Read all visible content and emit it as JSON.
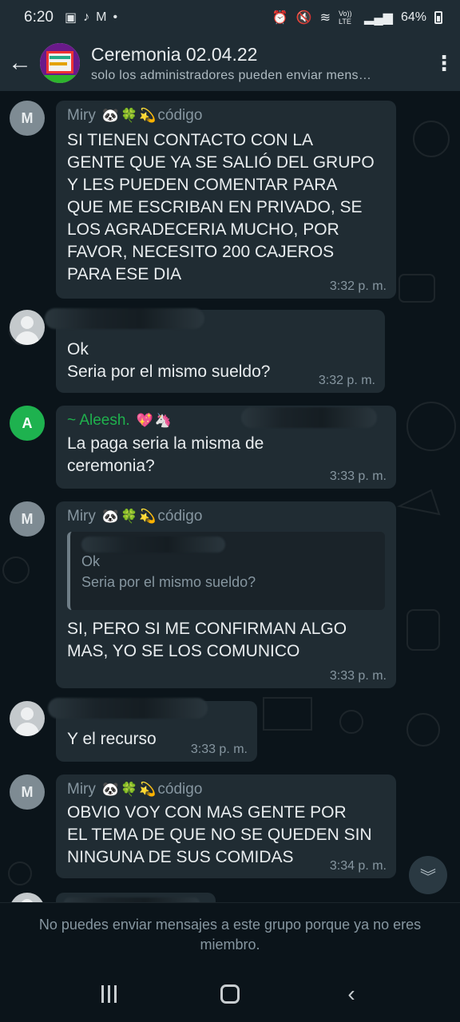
{
  "status": {
    "time": "6:20",
    "icons_left": [
      "gallery-icon",
      "tiktok-icon",
      "gmail-icon",
      "dot-icon"
    ],
    "icons_right": [
      "alarm-icon",
      "mute-icon",
      "wifi-icon",
      "volte-icon",
      "signal-icon"
    ],
    "volte": "Vo)) LTE",
    "battery": "64%"
  },
  "header": {
    "title": "Ceremonia 02.04.22",
    "subtitle": "solo los administradores pueden enviar mens…"
  },
  "messages": [
    {
      "sender": "Miry",
      "sender_suffix": "código",
      "emojis": [
        "🐼",
        "🍀",
        "💫"
      ],
      "avatar_letter": "M",
      "text": "SI TIENEN CONTACTO CON LA\nGENTE QUE YA SE SALIÓ DEL GRUPO\nY LES PUEDEN COMENTAR PARA\nQUE ME ESCRIBAN EN PRIVADO, SE\nLOS AGRADECERIA MUCHO, POR\nFAVOR, NECESITO 200 CAJEROS\nPARA ESE DIA",
      "time": "3:32 p. m."
    },
    {
      "text": "Ok\nSeria por el mismo sueldo?",
      "time": "3:32 p. m."
    },
    {
      "sender": "~ Aleesh.",
      "emojis": [
        "💖",
        "🦄"
      ],
      "avatar_letter": "A",
      "text": "La paga seria la misma de\nceremonia?",
      "time": "3:33 p. m."
    },
    {
      "sender": "Miry",
      "sender_suffix": "código",
      "emojis": [
        "🐼",
        "🍀",
        "💫"
      ],
      "avatar_letter": "M",
      "quote_line1": "Ok",
      "quote_line2": "Seria por el mismo sueldo?",
      "text": "SI, PERO SI ME CONFIRMAN ALGO\nMAS, YO SE LOS COMUNICO",
      "time": "3:33 p. m."
    },
    {
      "text": "Y el recurso",
      "time": "3:33 p. m."
    },
    {
      "sender": "Miry",
      "sender_suffix": "código",
      "emojis": [
        "🐼",
        "🍀",
        "💫"
      ],
      "avatar_letter": "M",
      "text": "OBVIO VOY CON MAS GENTE POR\nEL TEMA DE QUE NO SE QUEDEN SIN\nNINGUNA DE SUS COMIDAS",
      "time": "3:34 p. m."
    }
  ],
  "footer": {
    "notice": "No puedes enviar mensajes a este grupo porque ya no eres miembro."
  },
  "colors": {
    "background": "#0b141a",
    "bar": "#1f2c34",
    "bubble": "#202c33",
    "green_sender": "#1fb14d",
    "avatar_green": "#1eb24f"
  }
}
